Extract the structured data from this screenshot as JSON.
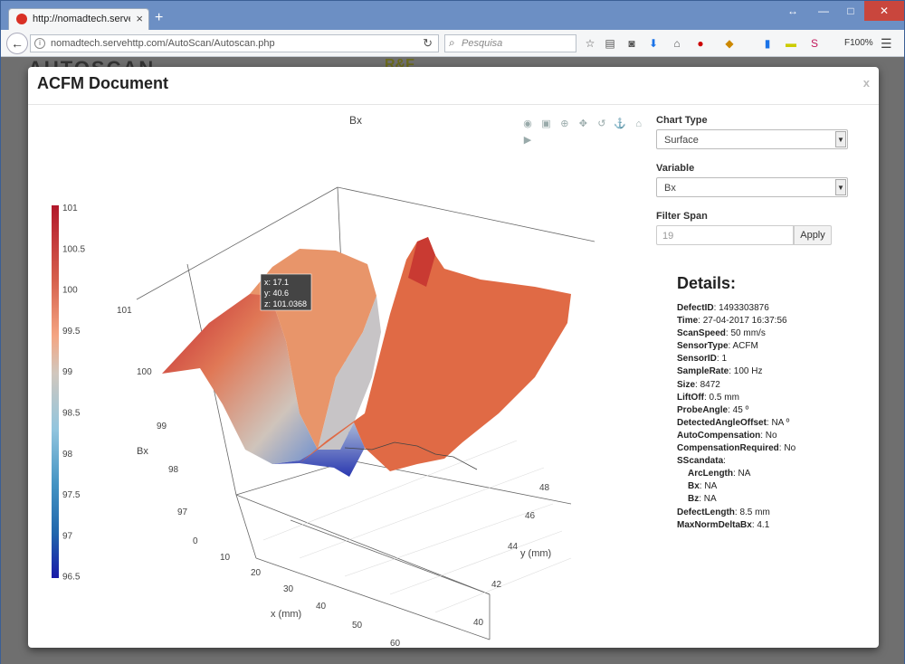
{
  "browser": {
    "tab_title": "http://nomadtech.servehttp.",
    "url": "nomadtech.servehttp.com/AutoScan/Autoscan.php",
    "search_placeholder": "Pesquisa",
    "zoom": "F100%"
  },
  "page": {
    "logo": "AUTOSCAN",
    "logo2": "R&F"
  },
  "modal": {
    "title": "ACFM Document",
    "close": "x"
  },
  "chart_data": {
    "type": "surface",
    "title": "Bx",
    "xlabel": "x (mm)",
    "ylabel": "y (mm)",
    "zlabel": "Bx",
    "x_ticks": [
      "0",
      "10",
      "20",
      "30",
      "40",
      "50",
      "60"
    ],
    "y_ticks": [
      "40",
      "42",
      "44",
      "46",
      "48"
    ],
    "z_ticks": [
      "97",
      "98",
      "99",
      "100",
      "101"
    ],
    "colorbar_ticks": [
      "101",
      "100.5",
      "100",
      "99.5",
      "99",
      "98.5",
      "98",
      "97.5",
      "97",
      "96.5"
    ],
    "colorscale": [
      "#b2182b",
      "#d6604d",
      "#f4a582",
      "#d1c7bd",
      "#92c5de",
      "#4393c3",
      "#2166ac",
      "#1a1aa8"
    ],
    "tooltip": {
      "x": "x: 17.1",
      "y": "y: 40.6",
      "z": "z: 101.0368"
    }
  },
  "controls": {
    "chart_type_label": "Chart Type",
    "chart_type_value": "Surface",
    "variable_label": "Variable",
    "variable_value": "Bx",
    "filter_label": "Filter Span",
    "filter_value": "19",
    "apply_label": "Apply"
  },
  "details": {
    "title": "Details:",
    "rows": [
      {
        "k": "DefectID",
        "v": ": 1493303876"
      },
      {
        "k": "Time",
        "v": ": 27-04-2017 16:37:56"
      },
      {
        "k": "ScanSpeed",
        "v": ": 50 mm/s"
      },
      {
        "k": "SensorType",
        "v": ": ACFM"
      },
      {
        "k": "SensorID",
        "v": ": 1"
      },
      {
        "k": "SampleRate",
        "v": ": 100 Hz"
      },
      {
        "k": "Size",
        "v": ": 8472"
      },
      {
        "k": "LiftOff",
        "v": ": 0.5 mm"
      },
      {
        "k": "ProbeAngle",
        "v": ": 45 º"
      },
      {
        "k": "DetectedAngleOffset",
        "v": ": NA º"
      },
      {
        "k": "AutoCompensation",
        "v": ": No"
      },
      {
        "k": "CompensationRequired",
        "v": ": No"
      },
      {
        "k": "SScandata",
        "v": ":"
      },
      {
        "k": "ArcLength",
        "v": ": NA"
      },
      {
        "k": "Bx",
        "v": ": NA"
      },
      {
        "k": "Bz",
        "v": ": NA"
      },
      {
        "k": "DefectLength",
        "v": ": 8.5 mm"
      },
      {
        "k": "MaxNormDeltaBx",
        "v": ": 4.1"
      }
    ]
  }
}
